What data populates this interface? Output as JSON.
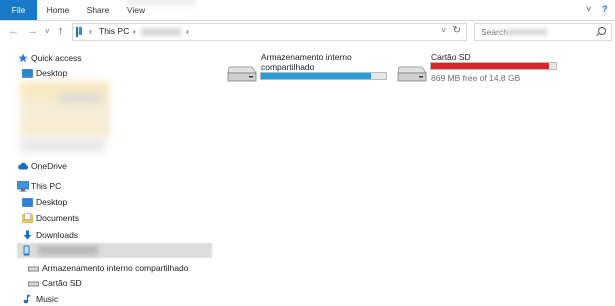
{
  "ribbon": {
    "tabs": [
      "File",
      "Home",
      "Share",
      "View"
    ],
    "collapse_glyph": "˅",
    "help_glyph": "?"
  },
  "address": {
    "back_glyph": "←",
    "forward_glyph": "→",
    "recent_glyph": "˅",
    "up_glyph": "↑",
    "separator_glyph": "›",
    "this_pc": "This PC",
    "dropdown_glyph": "˅",
    "refresh_glyph": "↻",
    "search_placeholder": "Search"
  },
  "nav": {
    "quick_access": "Quick access",
    "quick_access_desktop": "Desktop",
    "onedrive": "OneDrive",
    "this_pc": "This PC",
    "desktop": "Desktop",
    "documents": "Documents",
    "downloads": "Downloads",
    "storage_internal": "Armazenamento interno compartilhado",
    "sd_card": "Cartão SD",
    "music": "Music"
  },
  "drives": [
    {
      "name_line1": "Armazenamento interno",
      "name_line2": "compartilhado",
      "used_fraction": 0.88,
      "bar_color": "#26a0da",
      "free_text": ""
    },
    {
      "name_line1": "Cartão SD",
      "name_line2": "",
      "used_fraction": 0.94,
      "bar_color": "#da2626",
      "free_text": "869 MB free of 14,8 GB"
    }
  ],
  "colors": {
    "accent": "#1979ca",
    "bar_normal": "#26a0da",
    "bar_full": "#da2626",
    "folder_yellow": "#f2c94c"
  },
  "icons": [
    "back-arrow-icon",
    "forward-arrow-icon",
    "up-arrow-icon",
    "computer-icon",
    "refresh-icon",
    "search-icon",
    "star-icon",
    "desktop-folder-icon",
    "cloud-icon",
    "documents-folder-icon",
    "download-arrow-icon",
    "drive-icon",
    "music-note-icon"
  ]
}
